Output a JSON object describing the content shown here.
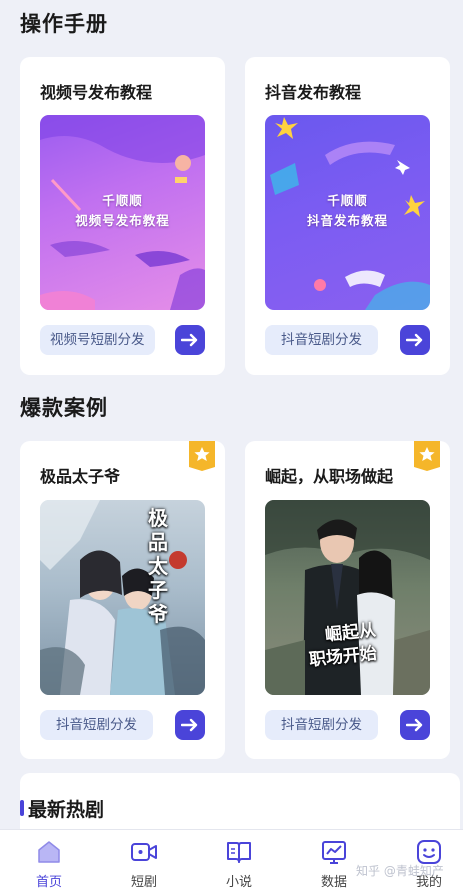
{
  "sections": {
    "manual_title": "操作手册",
    "cases_title": "爆款案例",
    "hot_title": "最新热剧"
  },
  "manual_cards": [
    {
      "title": "视频号发布教程",
      "thumb_line1": "千顺顺",
      "thumb_line2": "视频号发布教程",
      "tag": "视频号短剧分发"
    },
    {
      "title": "抖音发布教程",
      "thumb_line1": "千顺顺",
      "thumb_line2": "抖音发布教程",
      "tag": "抖音短剧分发"
    }
  ],
  "case_cards": [
    {
      "title": "极品太子爷",
      "poster_text": "极品太子爷",
      "tag": "抖音短剧分发"
    },
    {
      "title": "崛起，从职场做起",
      "poster_text_1": "崛起从",
      "poster_text_2": "职场开始",
      "tag": "抖音短剧分发"
    }
  ],
  "tabbar": {
    "items": [
      {
        "label": "首页",
        "icon": "home-icon",
        "active": true
      },
      {
        "label": "短剧",
        "icon": "video-camera-icon",
        "active": false
      },
      {
        "label": "小说",
        "icon": "book-icon",
        "active": false
      },
      {
        "label": "数据",
        "icon": "chart-icon",
        "active": false
      },
      {
        "label": "我的",
        "icon": "profile-icon",
        "active": false
      }
    ]
  },
  "watermark": "知乎 @青蛙知产",
  "colors": {
    "accent": "#4a44d9",
    "background": "#eef0f7",
    "tag_bg": "#e6ecfb",
    "badge": "#f5b62a"
  }
}
